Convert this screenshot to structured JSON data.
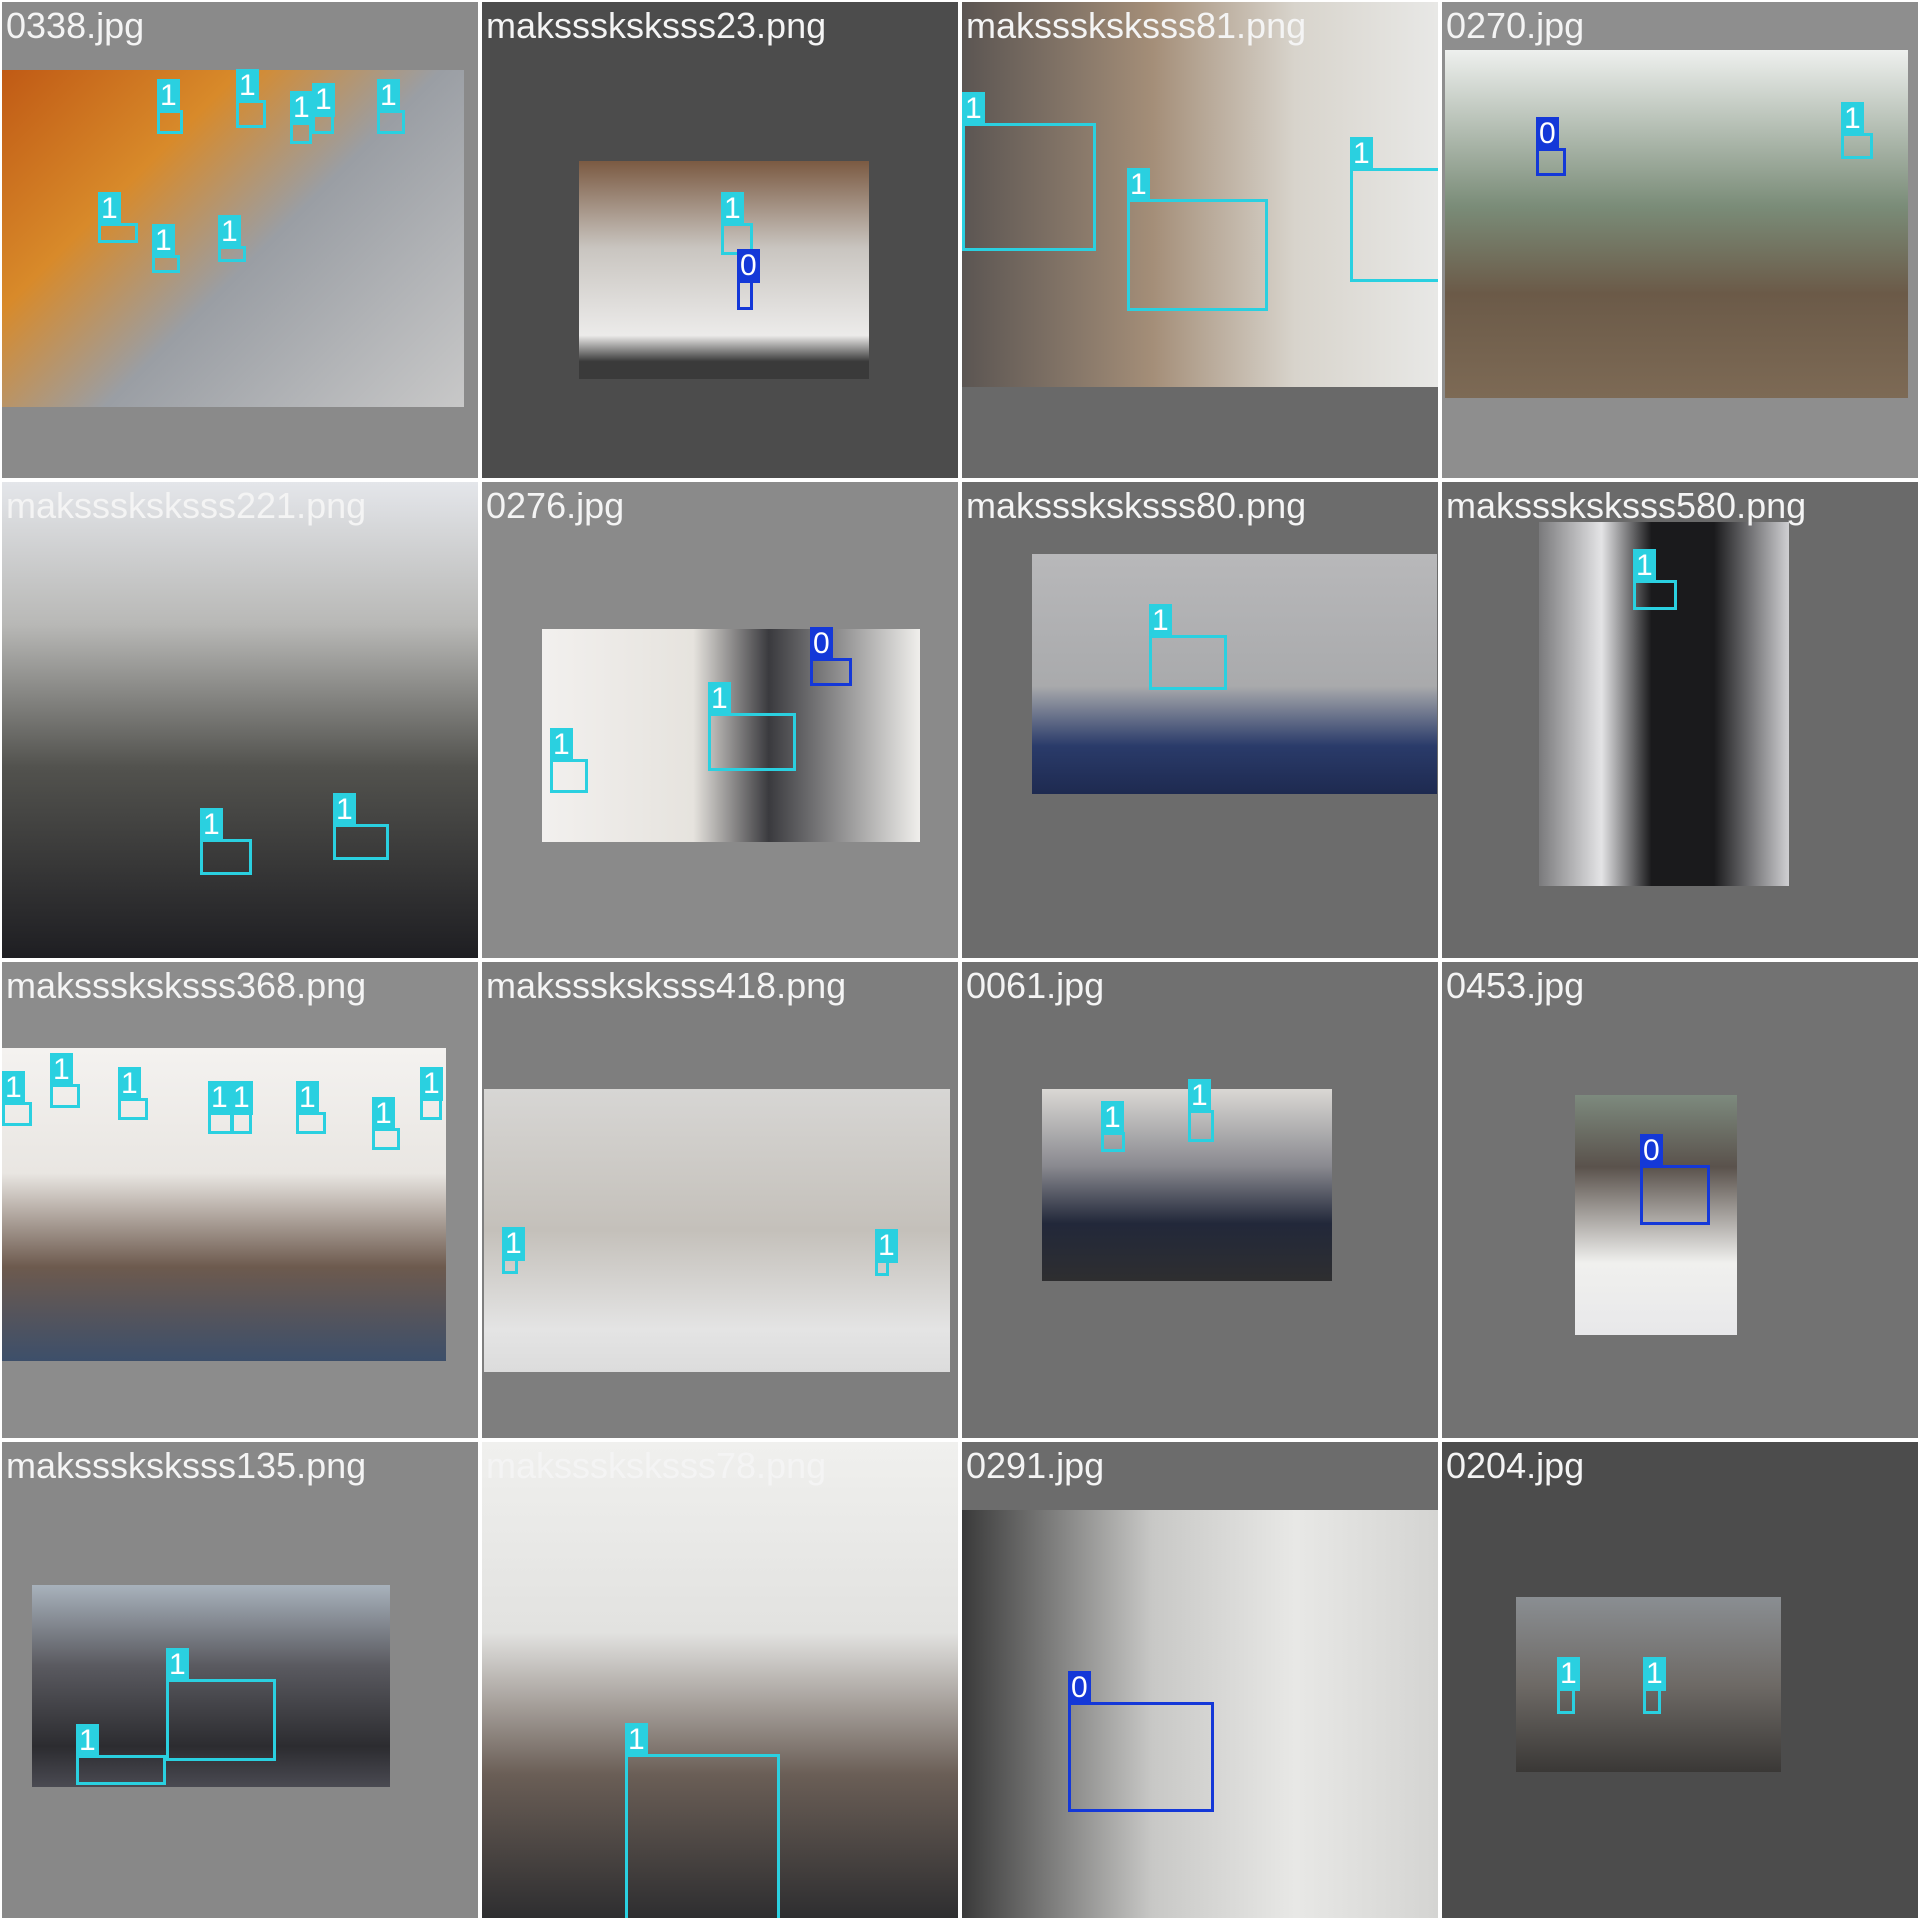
{
  "colors": {
    "class_1": "#2ad0e0",
    "class_0": "#1438d8",
    "label_text": "#ffffff",
    "filename_text": "#f4f4f4"
  },
  "tiles": [
    {
      "filename": "0338.jpg",
      "labels": [
        "1",
        "1",
        "1",
        "1",
        "1",
        "1",
        "1",
        "1"
      ]
    },
    {
      "filename": "maksssksksss23.png",
      "labels": [
        "1",
        "0"
      ]
    },
    {
      "filename": "maksssksksss81.png",
      "labels": [
        "1",
        "1",
        "1"
      ]
    },
    {
      "filename": "0270.jpg",
      "labels": [
        "0",
        "1"
      ]
    },
    {
      "filename": "maksssksksss221.png",
      "labels": [
        "1",
        "1"
      ]
    },
    {
      "filename": "0276.jpg",
      "labels": [
        "0",
        "1",
        "1"
      ]
    },
    {
      "filename": "maksssksksss80.png",
      "labels": [
        "1"
      ]
    },
    {
      "filename": "maksssksksss580.png",
      "labels": [
        "1"
      ]
    },
    {
      "filename": "maksssksksss368.png",
      "labels": [
        "1",
        "1",
        "1",
        "1",
        "1",
        "1",
        "1",
        "1"
      ]
    },
    {
      "filename": "maksssksksss418.png",
      "labels": [
        "1",
        "1"
      ]
    },
    {
      "filename": "0061.jpg",
      "labels": [
        "1",
        "1"
      ]
    },
    {
      "filename": "0453.jpg",
      "labels": [
        "0"
      ]
    },
    {
      "filename": "maksssksksss135.png",
      "labels": [
        "1",
        "1"
      ]
    },
    {
      "filename": "maksssksksss78.png",
      "labels": [
        "1"
      ]
    },
    {
      "filename": "0291.jpg",
      "labels": [
        "0"
      ]
    },
    {
      "filename": "0204.jpg",
      "labels": [
        "1",
        "1"
      ]
    }
  ]
}
